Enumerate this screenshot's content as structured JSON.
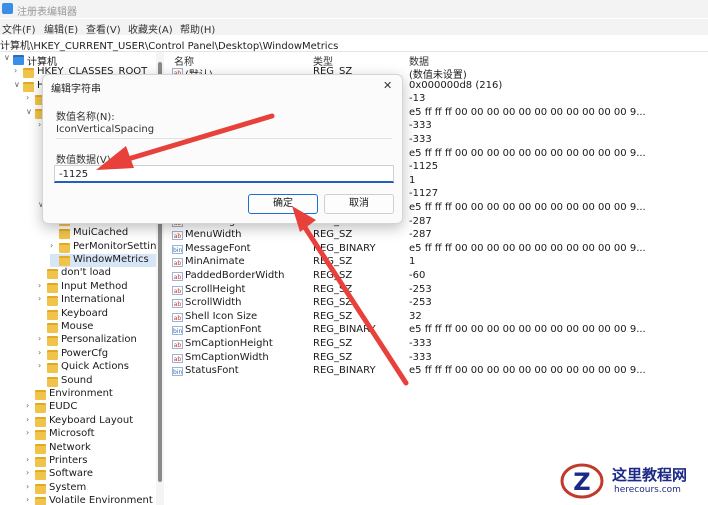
{
  "window": {
    "title": "注册表编辑器"
  },
  "menu": [
    "文件(F)",
    "编辑(E)",
    "查看(V)",
    "收藏夹(A)",
    "帮助(H)"
  ],
  "address": "计算机\\HKEY_CURRENT_USER\\Control Panel\\Desktop\\WindowMetrics",
  "tree": [
    {
      "label": "计算机",
      "chev": "∨"
    },
    {
      "label": "HKEY_CLASSES_ROOT",
      "chev": "›"
    },
    {
      "label": "H",
      "chev": "∨"
    },
    {
      "label": "",
      "chev": "›"
    },
    {
      "label": "",
      "chev": "∨"
    },
    {
      "label": "",
      "chev": "›"
    },
    {
      "label": "",
      "chev": ""
    },
    {
      "label": "",
      "chev": ""
    },
    {
      "label": "",
      "chev": ""
    },
    {
      "label": "",
      "chev": ""
    },
    {
      "label": "",
      "chev": ""
    },
    {
      "label": "",
      "chev": "∨"
    },
    {
      "label": "",
      "chev": ""
    },
    {
      "label": "MuiCached",
      "chev": ""
    },
    {
      "label": "PerMonitorSettin",
      "chev": "›"
    },
    {
      "label": "WindowMetrics",
      "chev": ""
    },
    {
      "label": "don't load",
      "chev": ""
    },
    {
      "label": "Input Method",
      "chev": "›"
    },
    {
      "label": "International",
      "chev": "›"
    },
    {
      "label": "Keyboard",
      "chev": ""
    },
    {
      "label": "Mouse",
      "chev": ""
    },
    {
      "label": "Personalization",
      "chev": "›"
    },
    {
      "label": "PowerCfg",
      "chev": "›"
    },
    {
      "label": "Quick Actions",
      "chev": "›"
    },
    {
      "label": "Sound",
      "chev": ""
    },
    {
      "label": "Environment",
      "chev": ""
    },
    {
      "label": "EUDC",
      "chev": "›"
    },
    {
      "label": "Keyboard Layout",
      "chev": "›"
    },
    {
      "label": "Microsoft",
      "chev": "›"
    },
    {
      "label": "Network",
      "chev": ""
    },
    {
      "label": "Printers",
      "chev": "›"
    },
    {
      "label": "Software",
      "chev": "›"
    },
    {
      "label": "System",
      "chev": "›"
    },
    {
      "label": "Volatile Environment",
      "chev": "›"
    }
  ],
  "list": {
    "headers": [
      "名称",
      "类型",
      "数据"
    ],
    "rows": [
      {
        "name": "(默认)",
        "type": "REG_SZ",
        "data": "(数值未设置)",
        "icon": "ab"
      },
      {
        "name": "",
        "type": "",
        "data": "0x000000d8 (216)",
        "icon": ""
      },
      {
        "name": "",
        "type": "",
        "data": "-13",
        "icon": ""
      },
      {
        "name": "",
        "type": "",
        "data": "e5 ff ff ff 00 00 00 00 00 00 00 00 00 00 00 9...",
        "icon": ""
      },
      {
        "name": "",
        "type": "",
        "data": "-333",
        "icon": ""
      },
      {
        "name": "",
        "type": "",
        "data": "-333",
        "icon": ""
      },
      {
        "name": "",
        "type": "",
        "data": "e5 ff ff ff 00 00 00 00 00 00 00 00 00 00 00 9...",
        "icon": ""
      },
      {
        "name": "",
        "type": "",
        "data": "-1125",
        "icon": ""
      },
      {
        "name": "",
        "type": "",
        "data": "1",
        "icon": ""
      },
      {
        "name": "",
        "type": "",
        "data": "-1127",
        "icon": ""
      },
      {
        "name": "",
        "type": "",
        "data": "e5 ff ff ff 00 00 00 00 00 00 00 00 00 00 00 9...",
        "icon": ""
      },
      {
        "name": "MenuHeight",
        "type": "REG_SZ",
        "data": "-287",
        "icon": "ab"
      },
      {
        "name": "MenuWidth",
        "type": "REG_SZ",
        "data": "-287",
        "icon": "ab"
      },
      {
        "name": "MessageFont",
        "type": "REG_BINARY",
        "data": "e5 ff ff ff 00 00 00 00 00 00 00 00 00 00 00 9...",
        "icon": "bin"
      },
      {
        "name": "MinAnimate",
        "type": "REG_SZ",
        "data": "1",
        "icon": "ab"
      },
      {
        "name": "PaddedBorderWidth",
        "type": "REG_SZ",
        "data": "-60",
        "icon": "ab"
      },
      {
        "name": "ScrollHeight",
        "type": "REG_SZ",
        "data": "-253",
        "icon": "ab"
      },
      {
        "name": "ScrollWidth",
        "type": "REG_SZ",
        "data": "-253",
        "icon": "ab"
      },
      {
        "name": "Shell Icon Size",
        "type": "REG_SZ",
        "data": "32",
        "icon": "ab"
      },
      {
        "name": "SmCaptionFont",
        "type": "REG_BINARY",
        "data": "e5 ff ff ff 00 00 00 00 00 00 00 00 00 00 00 9...",
        "icon": "bin"
      },
      {
        "name": "SmCaptionHeight",
        "type": "REG_SZ",
        "data": "-333",
        "icon": "ab"
      },
      {
        "name": "SmCaptionWidth",
        "type": "REG_SZ",
        "data": "-333",
        "icon": "ab"
      },
      {
        "name": "StatusFont",
        "type": "REG_BINARY",
        "data": "e5 ff ff ff 00 00 00 00 00 00 00 00 00 00 00 9...",
        "icon": "bin"
      }
    ]
  },
  "dialog": {
    "title": "编辑字符串",
    "close": "✕",
    "name_label": "数值名称(N):",
    "name_value": "IconVerticalSpacing",
    "data_label": "数值数据(V):",
    "data_value": "-1125",
    "ok_label": "确定",
    "cancel_label": "取消"
  },
  "watermark": {
    "title": "这里教程网",
    "url": "herecours.com"
  },
  "colors": {
    "arrow": "#e8403a",
    "accent": "#1f6fd0",
    "folder": "#f0c44a"
  }
}
